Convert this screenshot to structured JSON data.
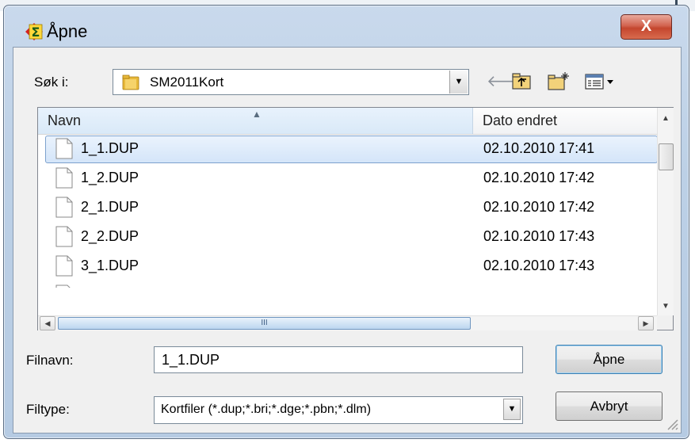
{
  "dialog": {
    "title": "Åpne",
    "close_label": "X"
  },
  "look_in": {
    "label": "Søk i:",
    "value": "SM2011Kort"
  },
  "toolbar": {
    "back_icon": "back-arrow-icon",
    "up_icon": "up-folder-icon",
    "new_folder_icon": "new-folder-icon",
    "views_icon": "view-menu-icon"
  },
  "list": {
    "columns": [
      "Navn",
      "Dato endret"
    ],
    "files": [
      {
        "name": "1_1.DUP",
        "date": "02.10.2010 17:41",
        "selected": true
      },
      {
        "name": "1_2.DUP",
        "date": "02.10.2010 17:42",
        "selected": false
      },
      {
        "name": "2_1.DUP",
        "date": "02.10.2010 17:42",
        "selected": false
      },
      {
        "name": "2_2.DUP",
        "date": "02.10.2010 17:43",
        "selected": false
      },
      {
        "name": "3_1.DUP",
        "date": "02.10.2010 17:43",
        "selected": false
      }
    ],
    "hscroll_grip": "III"
  },
  "filename": {
    "label": "Filnavn:",
    "value": "1_1.DUP"
  },
  "filetype": {
    "label": "Filtype:",
    "value": "Kortfiler (*.dup;*.bri;*.dge;*.pbn;*.dlm)"
  },
  "buttons": {
    "open": "Åpne",
    "cancel": "Avbryt"
  }
}
